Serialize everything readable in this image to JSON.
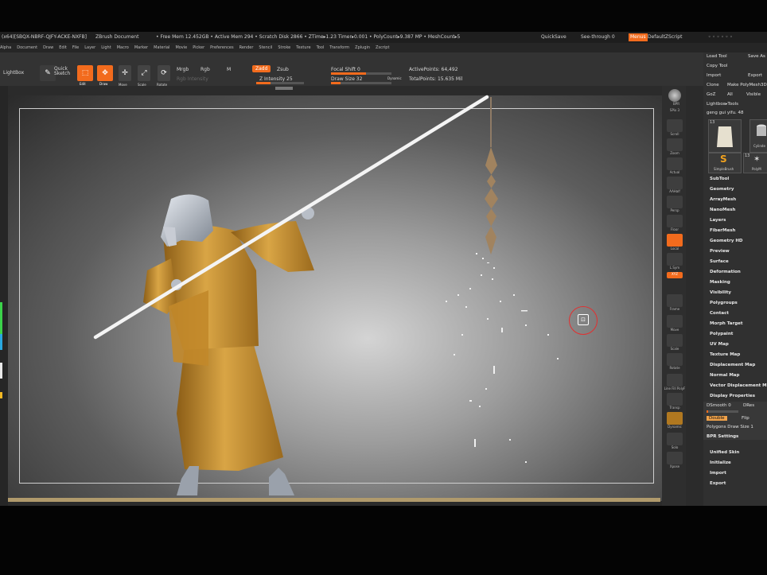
{
  "titlebar": {
    "app": "(x64)[SBQX-NBRF-QJFY-ACKE-NXFB]",
    "document": "ZBrush Document",
    "stats": "• Free Mem 12.452GB • Active Mem 294 • Scratch Disk 2866 • ZTime▸1.23 Timer▸0.001 • PolyCount▸9.387 MP • MeshCount▸5",
    "quicksave": "QuickSave",
    "see_through": "See-through 0",
    "menus": "Menus",
    "script": "DefaultZScript"
  },
  "menubar": {
    "items": [
      "Alpha",
      "Document",
      "Draw",
      "Edit",
      "File",
      "Layer",
      "Light",
      "Macro",
      "Marker",
      "Material",
      "Movie",
      "Picker",
      "Preferences",
      "Render",
      "Stencil",
      "Stroke",
      "Texture",
      "Tool",
      "Transform",
      "Zplugin",
      "Zscript"
    ]
  },
  "toolbar": {
    "lightbox": "LightBox",
    "quick_sketch": "Quick Sketch",
    "edit": "Edit",
    "draw": "Draw",
    "move": "Move",
    "scale": "Scale",
    "rotate": "Rotate",
    "mrgb": "Mrgb",
    "rgb": "Rgb",
    "m": "M",
    "rgb_intensity": "Rgb Intensity",
    "zadd": "Zadd",
    "zsub": "Zsub",
    "z_intensity": "Z Intensity 25",
    "focal_shift": "Focal Shift 0",
    "draw_size": "Draw Size 32",
    "dynamic": "Dynamic",
    "active_points": "ActivePoints: 64,492",
    "total_points": "TotalPoints: 15.635 Mil"
  },
  "right_tools": [
    {
      "name": "bpr",
      "label": "BPR"
    },
    {
      "name": "spix",
      "label": "SPix 3"
    },
    {
      "name": "scroll",
      "label": "Scroll"
    },
    {
      "name": "zoom",
      "label": "Zoom"
    },
    {
      "name": "actual",
      "label": "Actual"
    },
    {
      "name": "aahalf",
      "label": "AAHalf"
    },
    {
      "name": "persp",
      "label": "Persp"
    },
    {
      "name": "floor",
      "label": "Floor"
    },
    {
      "name": "local",
      "label": "Local"
    },
    {
      "name": "lsym",
      "label": "L.Sym"
    },
    {
      "name": "xyz",
      "label": "XYZ"
    },
    {
      "name": "frame",
      "label": "Frame"
    },
    {
      "name": "move",
      "label": "Move"
    },
    {
      "name": "scale",
      "label": "Scale"
    },
    {
      "name": "rotate",
      "label": "Rotate"
    },
    {
      "name": "linefill",
      "label": "Line Fill PolyF"
    },
    {
      "name": "transp",
      "label": "Transp"
    },
    {
      "name": "dynamic",
      "label": "Dynamic"
    },
    {
      "name": "solo",
      "label": "Solo"
    },
    {
      "name": "xpose",
      "label": "Xpose"
    }
  ],
  "palette": {
    "load_tool": "Load Tool",
    "save_as": "Save As",
    "copy_tool": "Copy Tool",
    "import": "Import",
    "export": "Export",
    "clone": "Clone",
    "make_polymesh": "Make PolyMesh3D",
    "goz": "GoZ",
    "all": "All",
    "visible": "Visible",
    "lightbox_tools": "Lightbox▸Tools",
    "current_tool": "geng gui yifu. 48",
    "thumb_count": "13",
    "thumb2_count": "13",
    "simplebrush": "SimpleBrush",
    "cylinder": "Cylinde",
    "polymesh": "PolyM",
    "subtool_items": [
      "SubTool",
      "Geometry",
      "ArrayMesh",
      "NanoMesh",
      "Layers",
      "FiberMesh",
      "Geometry HD",
      "Preview",
      "Surface",
      "Deformation",
      "Masking",
      "Visibility",
      "Polygroups",
      "Contact",
      "Morph Target",
      "Polypaint",
      "UV Map",
      "Texture Map",
      "Displacement Map",
      "Normal Map",
      "Vector Displacement M",
      "Display Properties"
    ],
    "dsmooth": "DSmooth 0",
    "dres": "DRes",
    "double": "Double",
    "flip": "Flip",
    "polygons_draw_size": "Polygons Draw Size 1",
    "bpr_settings": "BPR Settings",
    "bottom_items": [
      "Unified Skin",
      "Initialize",
      "Import",
      "Export"
    ]
  },
  "colors": {
    "accent": "#f26b1d",
    "robe": "#c8902c",
    "cursor_ring": "#e23030"
  }
}
